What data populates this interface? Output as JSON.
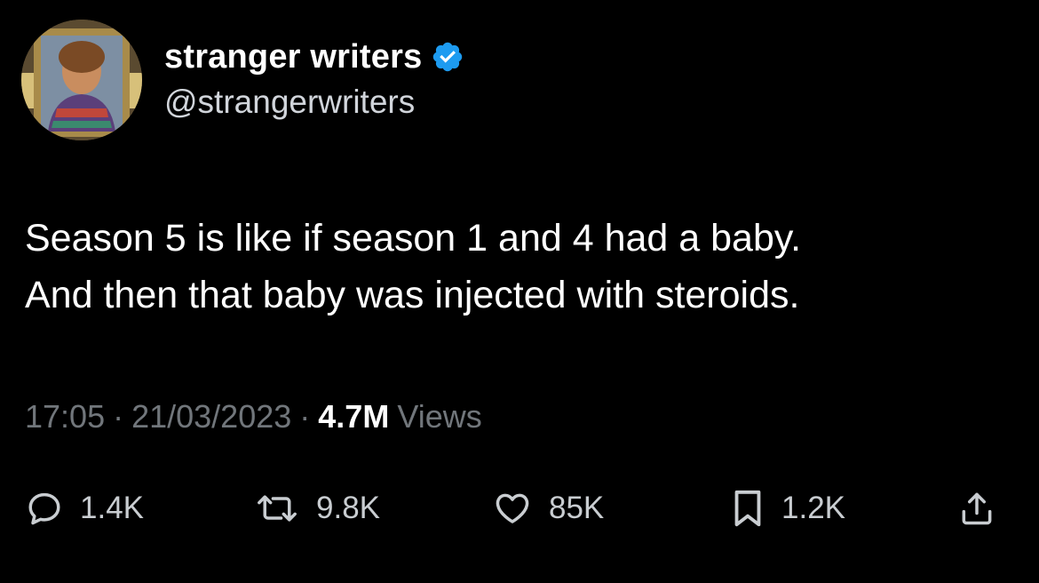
{
  "author": {
    "display_name": "stranger writers",
    "handle": "@strangerwriters",
    "verified": true,
    "verified_color": "#1d9bf0"
  },
  "tweet": {
    "text": "Season 5 is like if season 1 and 4 had a baby.\nAnd then that baby was injected with steroids."
  },
  "meta": {
    "time": "17:05",
    "date": "21/03/2023",
    "views_count": "4.7M",
    "views_label": "Views",
    "separator": "·"
  },
  "actions": {
    "reply": {
      "icon": "reply-icon",
      "count": "1.4K"
    },
    "retweet": {
      "icon": "retweet-icon",
      "count": "9.8K"
    },
    "like": {
      "icon": "heart-icon",
      "count": "85K"
    },
    "bookmark": {
      "icon": "bookmark-icon",
      "count": "1.2K"
    },
    "share": {
      "icon": "share-icon"
    }
  }
}
